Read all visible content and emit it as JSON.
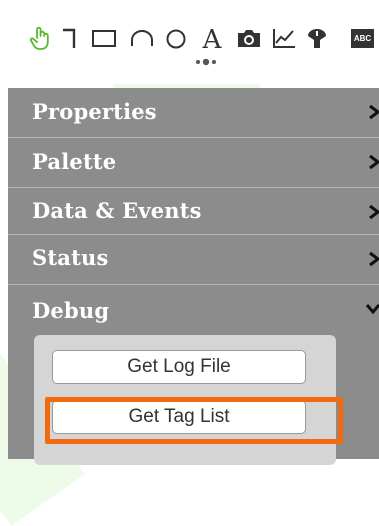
{
  "toolbar": {
    "tools": [
      {
        "name": "hand-pointer-icon"
      },
      {
        "name": "connector-line-icon"
      },
      {
        "name": "rectangle-icon"
      },
      {
        "name": "arc-icon"
      },
      {
        "name": "circle-icon"
      },
      {
        "name": "text-icon",
        "glyph": "A"
      },
      {
        "name": "camera-icon"
      },
      {
        "name": "trend-chart-icon"
      },
      {
        "name": "gauge-icon"
      },
      {
        "name": "abc-label-icon",
        "glyph": "ABC"
      }
    ],
    "grip": "grip-handle-icon"
  },
  "sections": {
    "properties": {
      "label": "Properties",
      "state": "collapsed"
    },
    "palette": {
      "label": "Palette",
      "state": "collapsed"
    },
    "data_events": {
      "label": "Data & Events",
      "state": "collapsed"
    },
    "status": {
      "label": "Status",
      "state": "collapsed"
    },
    "debug": {
      "label": "Debug",
      "state": "expanded",
      "buttons": {
        "get_log_file": "Get Log File",
        "get_tag_list": "Get Tag List"
      }
    }
  },
  "colors": {
    "section_bg": "#8c8c8c",
    "section_text": "#ffffff",
    "debug_body_bg": "#d5d5d5",
    "icon_green": "#5cb82e",
    "highlight": "#f26a0f"
  }
}
